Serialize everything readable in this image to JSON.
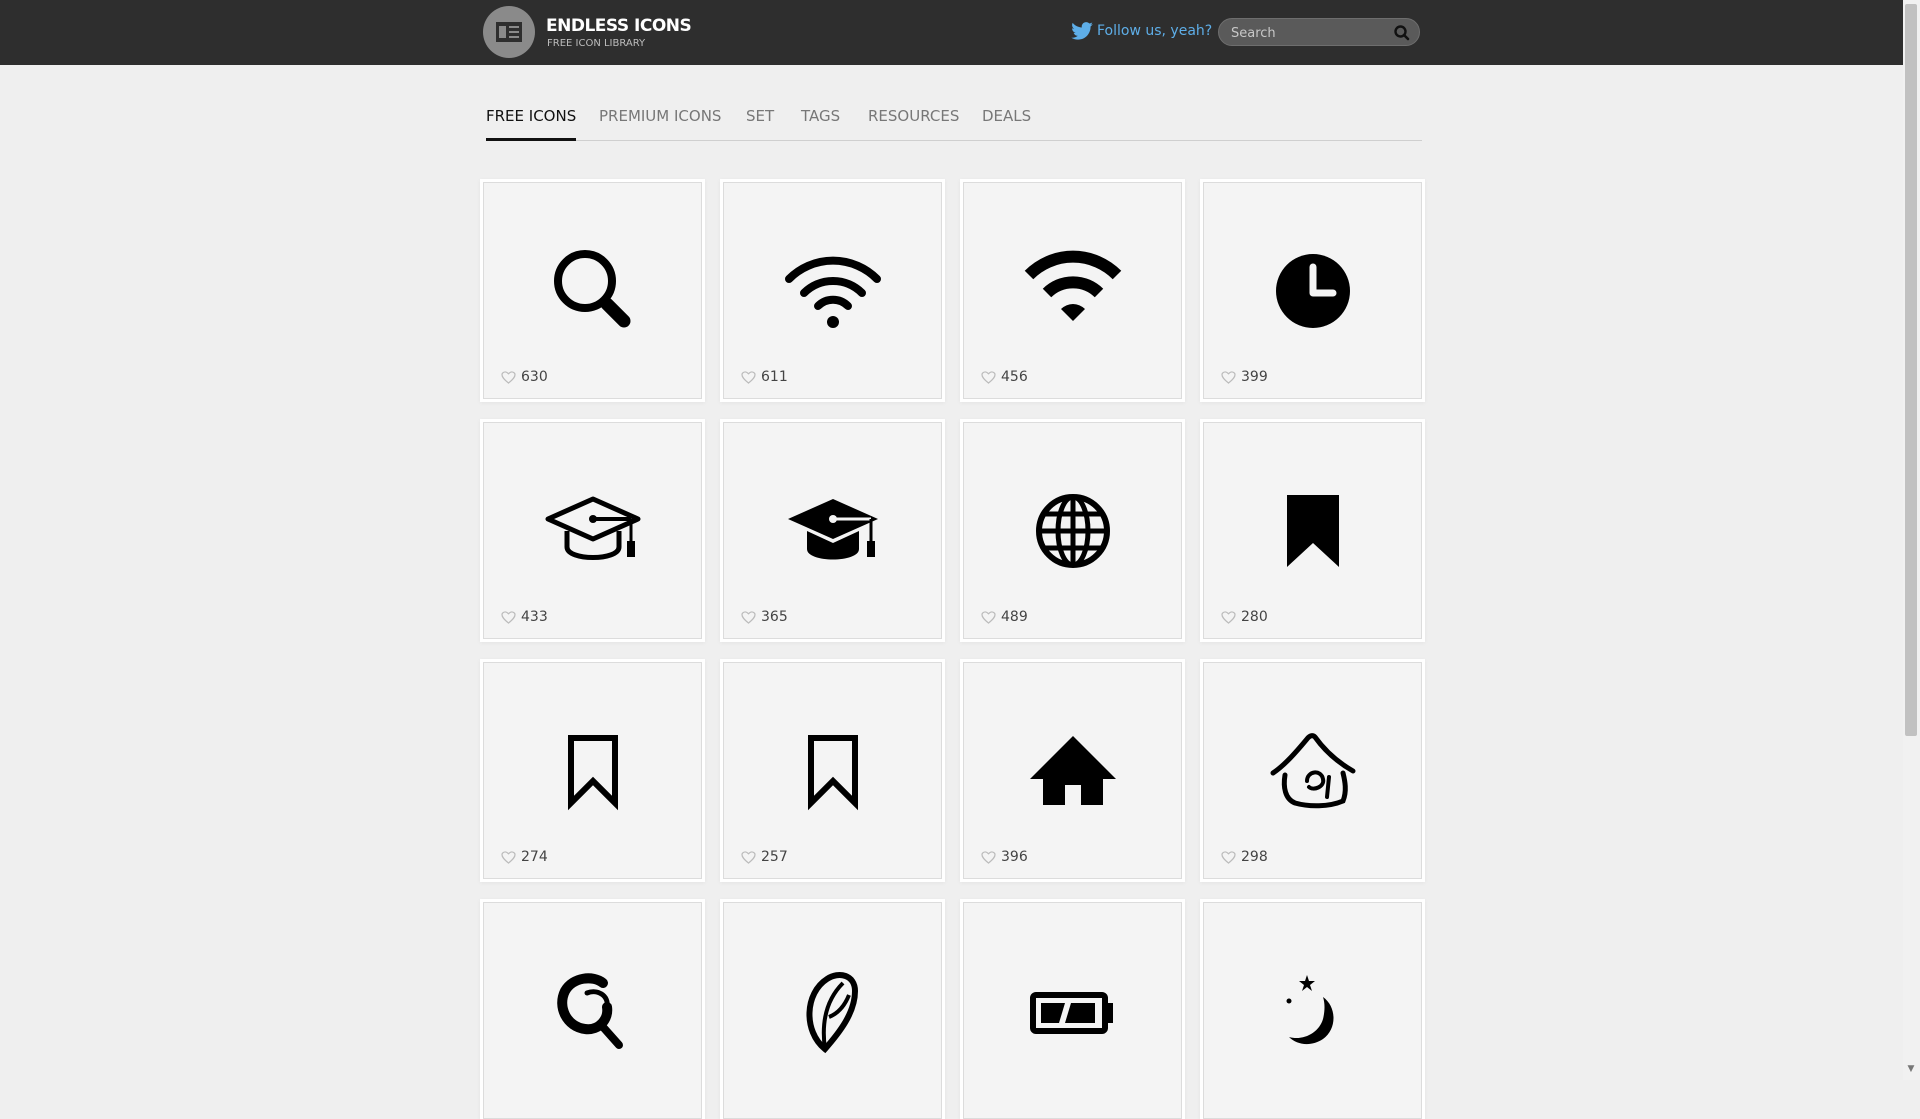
{
  "header": {
    "brand_name": "ENDLESS ICONS",
    "brand_tagline": "FREE ICON LIBRARY",
    "follow_label": "Follow us, yeah?",
    "search_placeholder": "Search",
    "accent_color": "#5eaee8"
  },
  "tabs": [
    {
      "label": "FREE ICONS",
      "active": true
    },
    {
      "label": "PREMIUM ICONS",
      "active": false
    },
    {
      "label": "SET",
      "active": false
    },
    {
      "label": "TAGS",
      "active": false
    },
    {
      "label": "RESOURCES",
      "active": false
    },
    {
      "label": "DEALS",
      "active": false
    }
  ],
  "icons": [
    {
      "icon": "search-icon",
      "likes": "630"
    },
    {
      "icon": "wifi-icon",
      "likes": "611"
    },
    {
      "icon": "wifi-bold-icon",
      "likes": "456"
    },
    {
      "icon": "clock-icon",
      "likes": "399"
    },
    {
      "icon": "graduation-cap-outline-icon",
      "likes": "433"
    },
    {
      "icon": "graduation-cap-icon",
      "likes": "365"
    },
    {
      "icon": "globe-icon",
      "likes": "489"
    },
    {
      "icon": "bookmark-icon",
      "likes": "280"
    },
    {
      "icon": "bookmark-outline-icon",
      "likes": "274"
    },
    {
      "icon": "bookmark-outline-alt-icon",
      "likes": "257"
    },
    {
      "icon": "home-icon",
      "likes": "396"
    },
    {
      "icon": "home-sketch-icon",
      "likes": "298"
    },
    {
      "icon": "search-sketch-icon",
      "likes": "",
      "cut_off": true
    },
    {
      "icon": "leaf-icon",
      "likes": "",
      "cut_off": true
    },
    {
      "icon": "battery-icon",
      "likes": "",
      "cut_off": true
    },
    {
      "icon": "moon-stars-icon",
      "likes": "",
      "cut_off": true
    }
  ]
}
